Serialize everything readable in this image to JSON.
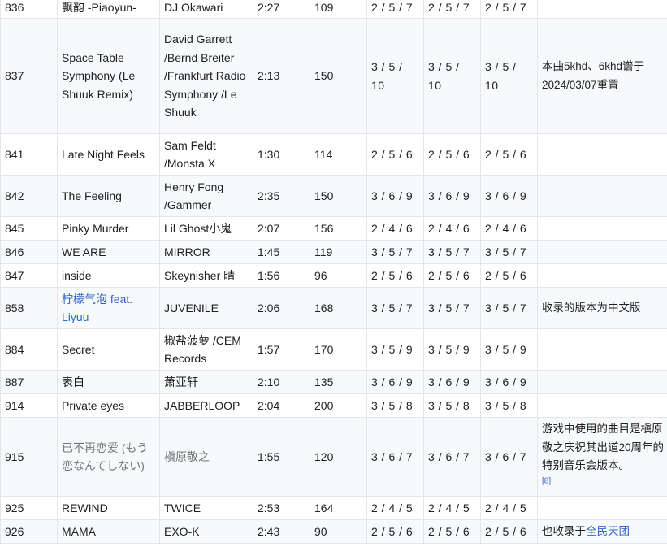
{
  "rows": [
    {
      "id": "836",
      "title": "飘韵 -Piaoyun-",
      "artist": "DJ Okawari",
      "time": "2:27",
      "bpm": "109",
      "d1": "2 / 5 / 7",
      "d2": "2 / 5 / 7",
      "d3": "2 / 5 / 7",
      "note": ""
    },
    {
      "id": "837",
      "title": "Space Table Symphony (Le Shuuk Remix)",
      "artist": "David Garrett /Bernd Breiter /Frankfurt Radio Symphony /Le Shuuk",
      "time": "2:13",
      "bpm": "150",
      "d1": "3 / 5 / 10",
      "d2": "3 / 5 / 10",
      "d3": "3 / 5 / 10",
      "note": "本曲5khd、6khd谱于2024/03/07重置"
    },
    {
      "id": "841",
      "title": "Late Night Feels",
      "artist": "Sam Feldt /Monsta X",
      "time": "1:30",
      "bpm": "114",
      "d1": "2 / 5 / 6",
      "d2": "2 / 5 / 6",
      "d3": "2 / 5 / 6",
      "note": ""
    },
    {
      "id": "842",
      "title": "The Feeling",
      "artist": "Henry Fong /Gammer",
      "time": "2:35",
      "bpm": "150",
      "d1": "3 / 6 / 9",
      "d2": "3 / 6 / 9",
      "d3": "3 / 6 / 9",
      "note": ""
    },
    {
      "id": "845",
      "title": "Pinky Murder",
      "artist": "Lil Ghost小鬼",
      "time": "2:07",
      "bpm": "156",
      "d1": "2 / 4 / 6",
      "d2": "2 / 4 / 6",
      "d3": "2 / 4 / 6",
      "note": ""
    },
    {
      "id": "846",
      "title": "WE ARE",
      "artist": "MIRROR",
      "time": "1:45",
      "bpm": "119",
      "d1": "3 / 5 / 7",
      "d2": "3 / 5 / 7",
      "d3": "3 / 5 / 7",
      "note": ""
    },
    {
      "id": "847",
      "title": "inside",
      "artist": "Skeynisher 晴",
      "time": "1:56",
      "bpm": "96",
      "d1": "2 / 5 / 6",
      "d2": "2 / 5 / 6",
      "d3": "2 / 5 / 6",
      "note": ""
    },
    {
      "id": "858",
      "title": "柠檬气泡 feat. Liyuu",
      "artist": "JUVENILE",
      "time": "2:06",
      "bpm": "168",
      "d1": "3 / 5 / 7",
      "d2": "3 / 5 / 7",
      "d3": "3 / 5 / 7",
      "note": "收录的版本为中文版"
    },
    {
      "id": "884",
      "title": "Secret",
      "artist": "椒盐菠萝 /CEM Records",
      "time": "1:57",
      "bpm": "170",
      "d1": "3 / 5 / 9",
      "d2": "3 / 5 / 9",
      "d3": "3 / 5 / 9",
      "note": ""
    },
    {
      "id": "887",
      "title": "表白",
      "artist": "萧亚轩",
      "time": "2:10",
      "bpm": "135",
      "d1": "3 / 6 / 9",
      "d2": "3 / 6 / 9",
      "d3": "3 / 6 / 9",
      "note": ""
    },
    {
      "id": "914",
      "title": "Private eyes",
      "artist": "JABBERLOOP",
      "time": "2:04",
      "bpm": "200",
      "d1": "3 / 5 / 8",
      "d2": "3 / 5 / 8",
      "d3": "3 / 5 / 8",
      "note": ""
    },
    {
      "id": "915",
      "title": "已不再恋爱 (もう恋なんてしない)",
      "artist": "槇原敬之",
      "time": "1:55",
      "bpm": "120",
      "d1": "3 / 6 / 7",
      "d2": "3 / 6 / 7",
      "d3": "3 / 6 / 7",
      "note": "游戏中使用的曲目是槇原敬之庆祝其出道20周年的特别音乐会版本。",
      "note_ref": "[8]"
    },
    {
      "id": "925",
      "title": "REWIND",
      "artist": "TWICE",
      "time": "2:53",
      "bpm": "164",
      "d1": "2 / 4 / 5",
      "d2": "2 / 4 / 5",
      "d3": "2 / 4 / 5",
      "note": ""
    },
    {
      "id": "926",
      "title": "MAMA",
      "artist": "EXO-K",
      "time": "2:43",
      "bpm": "90",
      "d1": "2 / 5 / 6",
      "d2": "2 / 5 / 6",
      "d3": "2 / 5 / 6",
      "note": "也收录于",
      "note_link": "全民天团"
    }
  ]
}
